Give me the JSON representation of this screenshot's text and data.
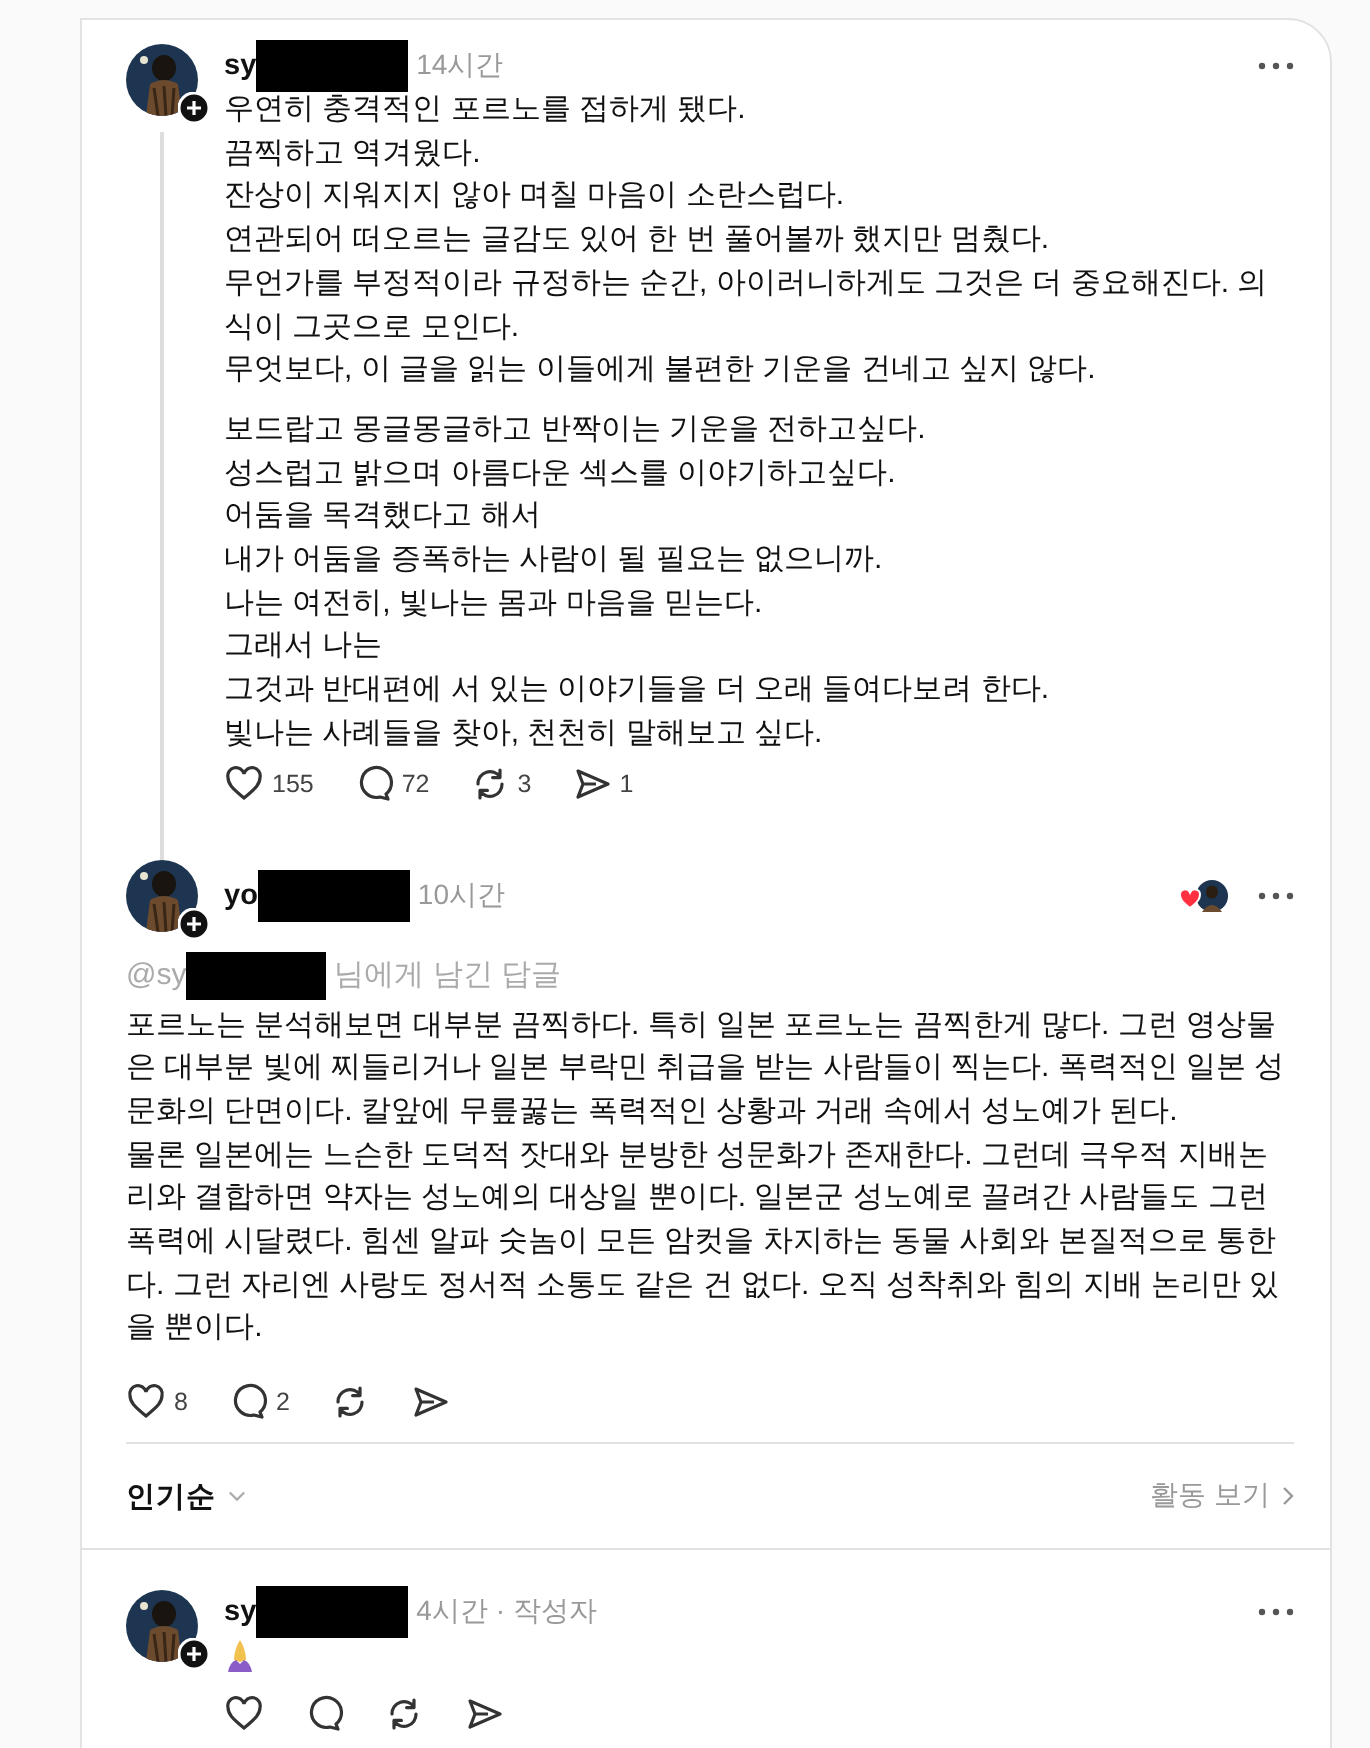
{
  "posts": [
    {
      "username": "sy",
      "redacted": true,
      "time": "14시간",
      "thread_line": true,
      "blocks": [
        [
          "우연히 충격적인 포르노를 접하게 됐다.",
          "끔찍하고 역겨웠다.",
          "잔상이 지워지지 않아 며칠 마음이 소란스럽다.",
          "연관되어 떠오르는 글감도 있어 한 번 풀어볼까 했지만 멈췄다.",
          "무언가를 부정적이라 규정하는 순간, 아이러니하게도 그것은 더 중요해진다. 의식이 그곳으로 모인다.",
          "무엇보다, 이 글을 읽는 이들에게 불편한 기운을 건네고 싶지 않다."
        ],
        [
          "보드랍고 몽글몽글하고 반짝이는 기운을 전하고싶다.",
          "성스럽고 밝으며 아름다운 섹스를 이야기하고싶다.",
          "어둠을 목격했다고 해서",
          "내가 어둠을 증폭하는 사람이 될 필요는 없으니까.",
          "나는 여전히, 빛나는 몸과 마음을 믿는다.",
          "그래서 나는",
          "그것과 반대편에 서 있는 이야기들을 더 오래 들여다보려 한다.",
          "빛나는 사례들을 찾아, 천천히 말해보고 싶다."
        ]
      ],
      "actions": [
        {
          "kind": "like",
          "count": "155"
        },
        {
          "kind": "reply",
          "count": "72"
        },
        {
          "kind": "repost",
          "count": "3"
        },
        {
          "kind": "share",
          "count": "1"
        }
      ]
    },
    {
      "username": "yo",
      "redacted": true,
      "time": "10시간",
      "liked_by_author": true,
      "reply_to": {
        "prefix": "@sy",
        "suffix": "님에게 남긴 답글"
      },
      "blocks": [
        [
          "포르노는 분석해보면 대부분 끔찍하다. 특히 일본 포르노는 끔찍한게 많다. 그런 영상물은 대부분 빛에 찌들리거나 일본 부락민 취급을 받는 사람들이 찍는다. 폭력적인 일본 성문화의 단면이다. 칼앞에 무릎꿇는 폭력적인 상황과 거래 속에서 성노예가 된다.",
          "물론 일본에는 느슨한 도덕적 잣대와 분방한 성문화가 존재한다. 그런데 극우적 지배논리와 결합하면 약자는 성노예의 대상일 뿐이다. 일본군 성노예로 끌려간 사람들도 그런 폭력에 시달렸다. 힘센 알파 숫놈이 모든 암컷을 차지하는 동물 사회와 본질적으로 통한다. 그런 자리엔 사랑도 정서적 소통도 같은 건 없다. 오직 성착취와 힘의 지배 논리만 있을 뿐이다."
        ]
      ],
      "actions": [
        {
          "kind": "like",
          "count": "8"
        },
        {
          "kind": "reply",
          "count": "2"
        },
        {
          "kind": "repost"
        },
        {
          "kind": "share"
        }
      ]
    }
  ],
  "sort": {
    "label": "인기순",
    "activity": "활동 보기"
  },
  "replies": [
    {
      "username": "sy",
      "redacted": true,
      "time": "4시간 · 작성자",
      "sticker": true,
      "actions": [
        {
          "kind": "like"
        },
        {
          "kind": "reply"
        },
        {
          "kind": "repost"
        },
        {
          "kind": "share"
        }
      ]
    }
  ]
}
